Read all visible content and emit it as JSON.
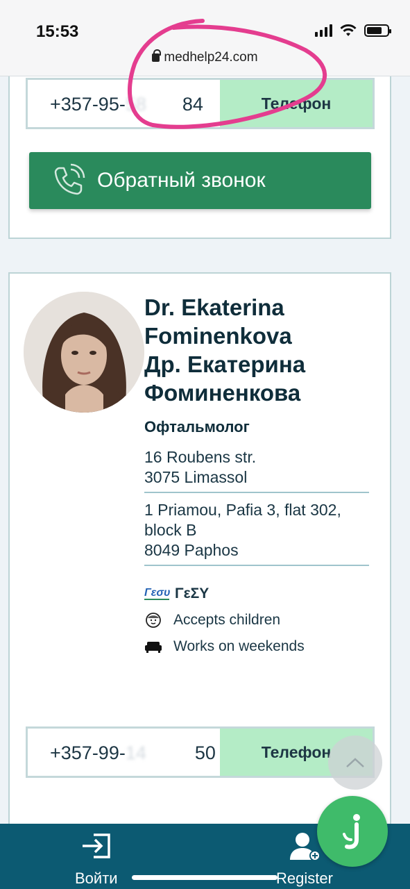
{
  "status_bar": {
    "time": "15:53"
  },
  "browser": {
    "url": "medhelp24.com"
  },
  "card1": {
    "phone": {
      "prefix": "+357-95-",
      "blurred": "58",
      "suffix": "84",
      "button_label": "Телефон"
    },
    "callback_label": "Обратный звонок"
  },
  "doctor": {
    "name_en_line1": "Dr. Ekaterina",
    "name_en_line2": "Fominenkova",
    "name_ru_line1": "Др. Екатерина",
    "name_ru_line2": "Фоминенкова",
    "specialty": "Офтальмолог",
    "address1_line1": "16 Roubens str.",
    "address1_line2": "3075 Limassol",
    "address2_line1": "1 Priamou, Pafia 3, flat 302,",
    "address2_line2": "block B",
    "address2_line3": "8049 Paphos",
    "gesy_logo": "Γεσυ",
    "gesy_label": "ΓεΣΥ",
    "feature_children": "Accepts children",
    "feature_weekends": "Works on weekends",
    "phone": {
      "prefix": "+357-99-",
      "blurred": "14",
      "suffix": "50",
      "button_label": "Телефон"
    }
  },
  "bottom_nav": {
    "login_label": "Войти",
    "register_label": "Register"
  },
  "colors": {
    "accent": "#2a8a5c",
    "phone_button": "#b4ecc6",
    "nav": "#0c5a72",
    "chat": "#3fbb6a",
    "scribble": "#e43d8f"
  }
}
